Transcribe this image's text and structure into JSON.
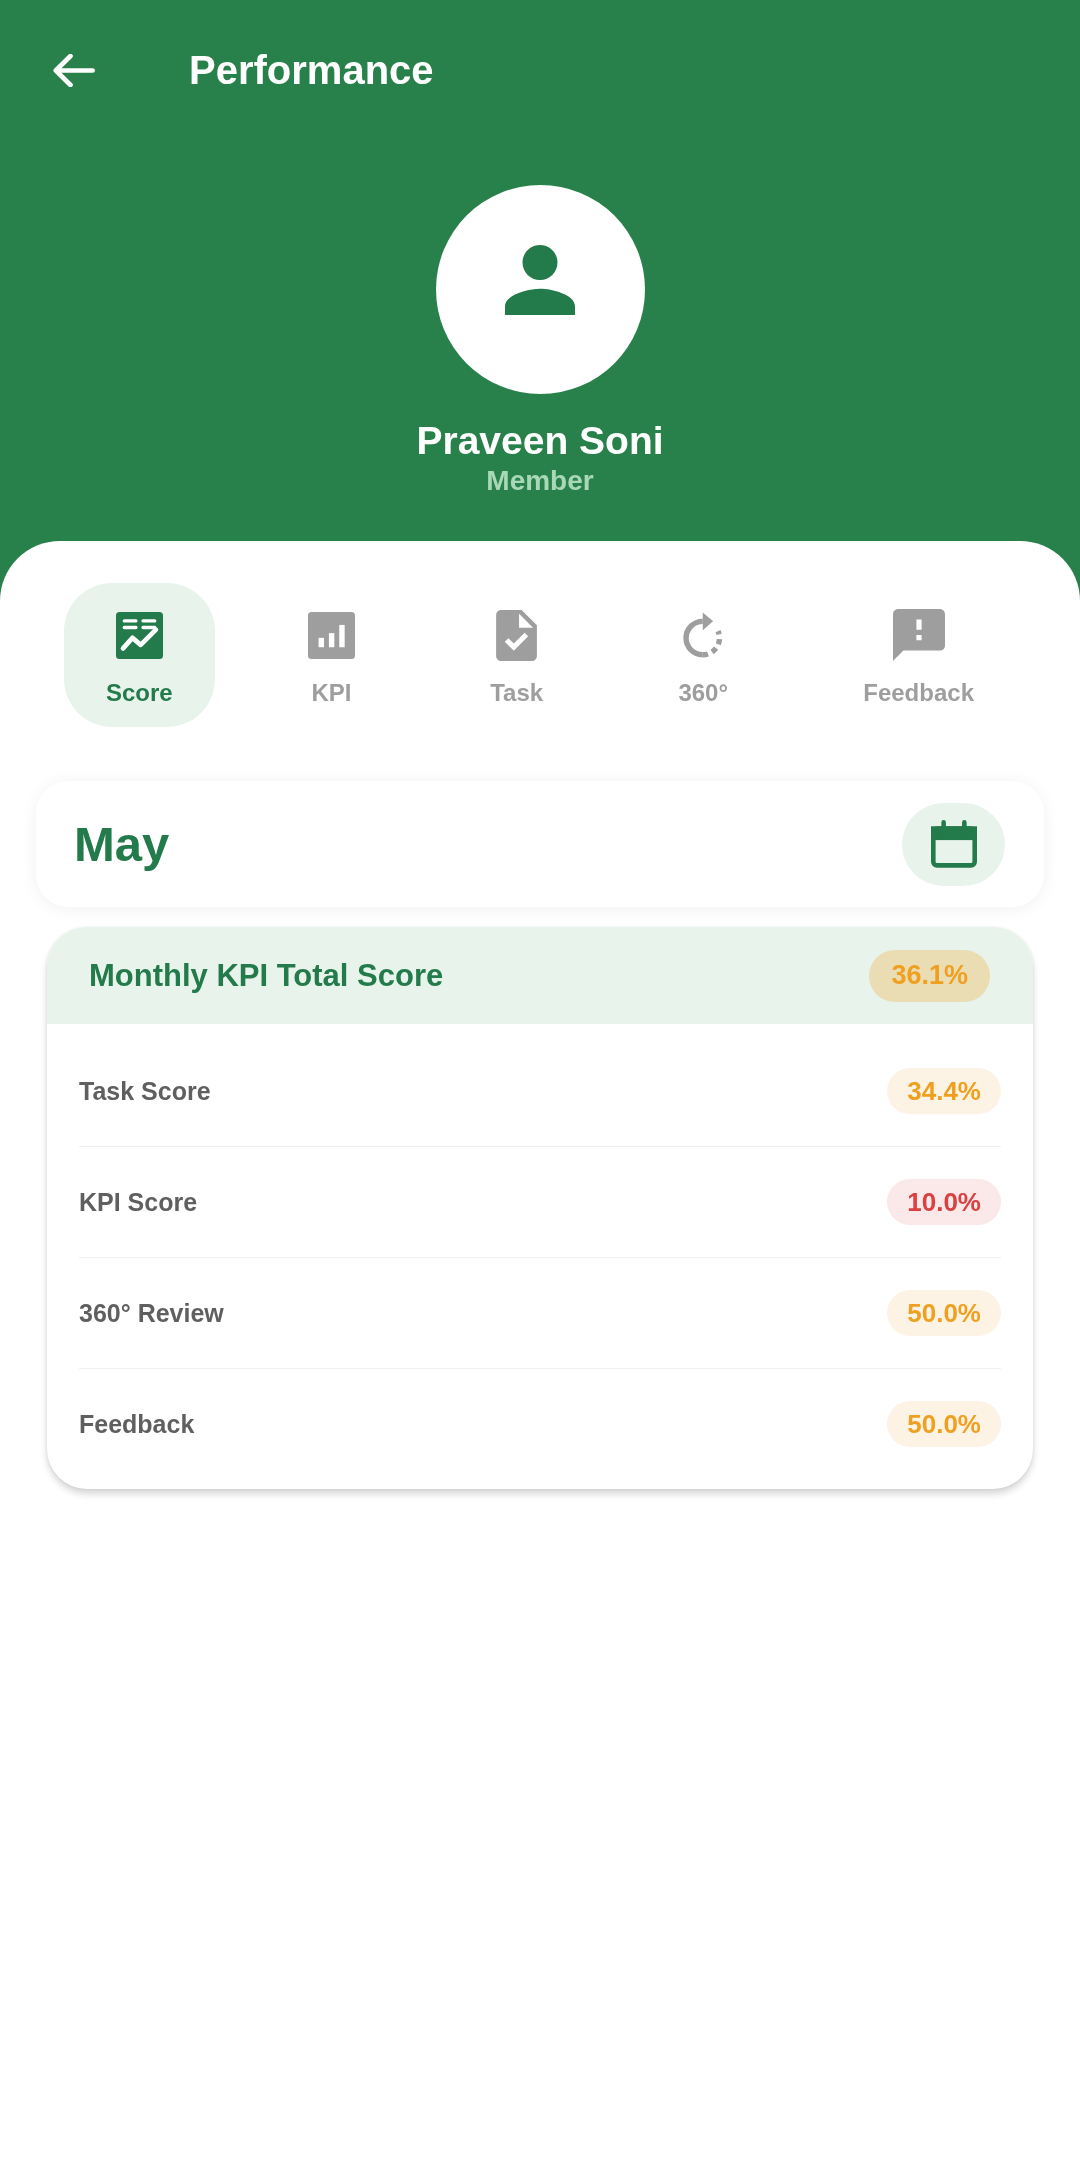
{
  "app_bar": {
    "title": "Performance"
  },
  "profile": {
    "name": "Praveen Soni",
    "role": "Member"
  },
  "tabs": [
    {
      "label": "Score",
      "selected": true
    },
    {
      "label": "KPI",
      "selected": false
    },
    {
      "label": "Task",
      "selected": false
    },
    {
      "label": "360°",
      "selected": false
    },
    {
      "label": "Feedback",
      "selected": false
    }
  ],
  "period": {
    "month": "May"
  },
  "score_card": {
    "title": "Monthly KPI Total Score",
    "total": {
      "value": "36.1%",
      "color": "#f0a020"
    },
    "rows": [
      {
        "label": "Task Score",
        "value": "34.4%",
        "color": "#f0a020"
      },
      {
        "label": "KPI Score",
        "value": "10.0%",
        "color": "#da4040"
      },
      {
        "label": "360° Review",
        "value": "50.0%",
        "color": "#f0a020"
      },
      {
        "label": "Feedback",
        "value": "50.0%",
        "color": "#f0a020"
      }
    ]
  }
}
